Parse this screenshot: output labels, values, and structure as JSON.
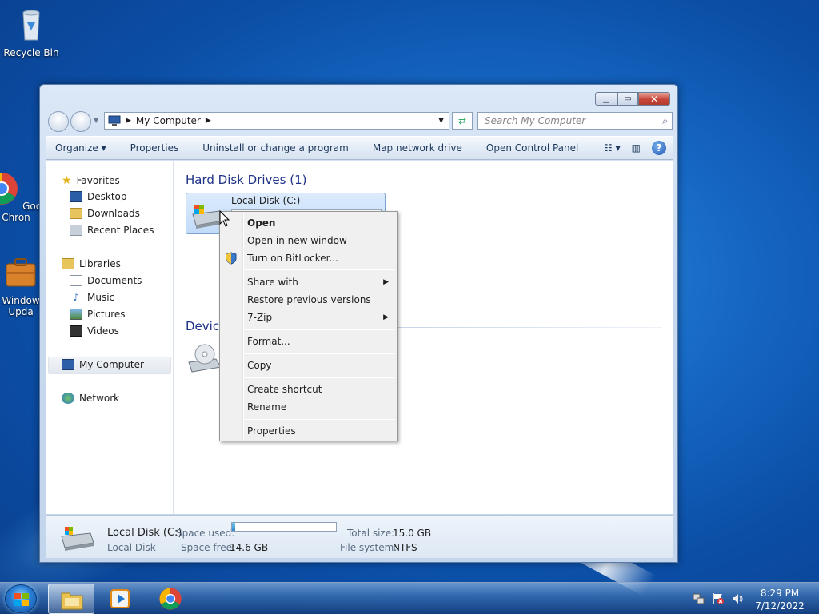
{
  "desktop": {
    "icons": [
      {
        "label": "Recycle Bin",
        "icon": "recycle-bin-icon"
      },
      {
        "label": "Goog\nChron",
        "icon": "chrome-icon"
      },
      {
        "label": "Window\nUpda",
        "icon": "windows-update-icon"
      }
    ]
  },
  "window": {
    "address": {
      "location": "My Computer"
    },
    "search": {
      "placeholder": "Search My Computer"
    },
    "toolbar": {
      "organize": "Organize ▾",
      "properties": "Properties",
      "uninstall": "Uninstall or change a program",
      "map_drive": "Map network drive",
      "control_panel": "Open Control Panel"
    },
    "nav": {
      "favorites": "Favorites",
      "desktop": "Desktop",
      "downloads": "Downloads",
      "recent": "Recent Places",
      "libraries": "Libraries",
      "documents": "Documents",
      "music": "Music",
      "pictures": "Pictures",
      "videos": "Videos",
      "my_computer": "My Computer",
      "network": "Network"
    },
    "content": {
      "hdd_group": "Hard Disk Drives (1)",
      "devices_group": "Devic",
      "drive_name": "Local Disk (C:)"
    },
    "details": {
      "name": "Local Disk (C:)",
      "type": "Local Disk",
      "space_used_label": "Space used:",
      "space_free_label": "Space free:",
      "space_free": "14.6 GB",
      "total_size_label": "Total size:",
      "total_size": "15.0 GB",
      "fs_label": "File system:",
      "fs": "NTFS",
      "used_fraction": 0.03
    }
  },
  "context_menu": {
    "open": "Open",
    "open_new": "Open in new window",
    "bitlocker": "Turn on BitLocker...",
    "share": "Share with",
    "restore": "Restore previous versions",
    "zip": "7-Zip",
    "format": "Format...",
    "copy": "Copy",
    "shortcut": "Create shortcut",
    "rename": "Rename",
    "properties": "Properties"
  },
  "taskbar": {
    "time": "8:29 PM",
    "date": "7/12/2022"
  }
}
